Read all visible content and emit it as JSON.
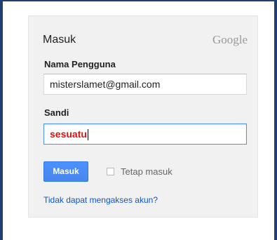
{
  "form": {
    "title": "Masuk",
    "brand": "Google",
    "username": {
      "label": "Nama Pengguna",
      "value": "misterslamet@gmail.com"
    },
    "password": {
      "label": "Sandi",
      "value": "sesuatu"
    },
    "signin_button": "Masuk",
    "stay_signed_in": {
      "label": "Tetap masuk",
      "checked": false
    },
    "help_link": "Tidak dapat mengakses akun?"
  },
  "colors": {
    "frame_border": "#1f3f73",
    "panel_background": "#f1f1f1",
    "button_blue": "#4d90fe",
    "link_blue": "#1155cc",
    "password_text": "#dd1111"
  }
}
